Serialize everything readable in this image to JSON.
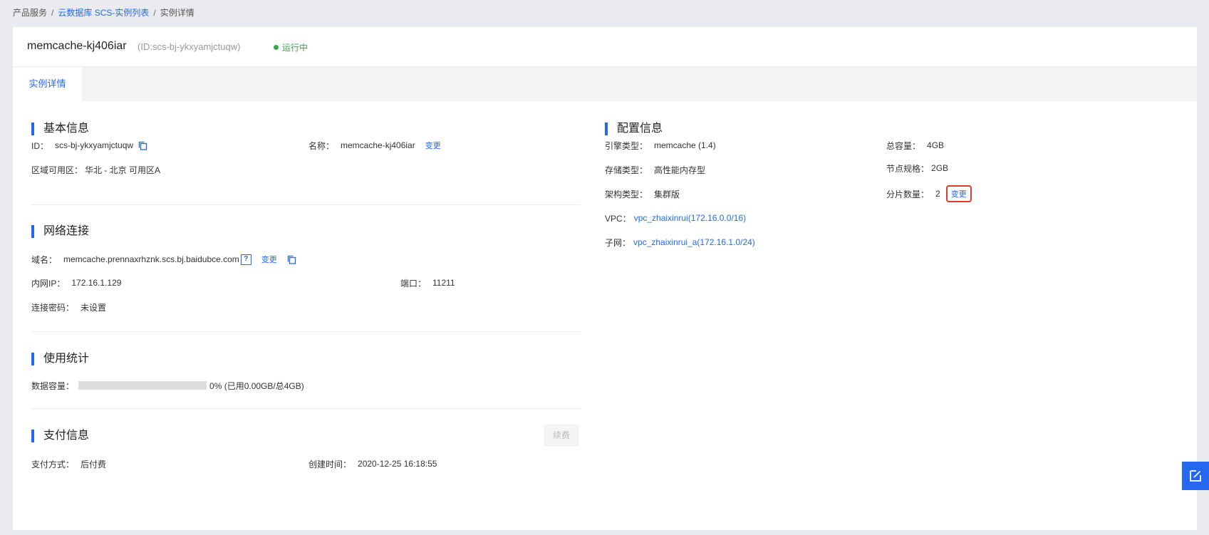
{
  "breadcrumb": {
    "items": [
      "产品服务",
      "云数据库 SCS-实例列表",
      "实例详情"
    ],
    "separator": "/"
  },
  "header": {
    "title": "memcache-kj406iar",
    "sub": "(ID:scs-bj-ykxyamjctuqw)",
    "status": "运行中"
  },
  "tabs": [
    {
      "label": "实例详情"
    }
  ],
  "basic": {
    "title": "基本信息",
    "id_label": "ID：",
    "id_value": "scs-bj-ykxyamjctuqw",
    "name_label": "名称：",
    "name_value": "memcache-kj406iar",
    "name_change": "变更",
    "zone_label": "区域可用区：",
    "zone_value": "华北 - 北京 可用区A"
  },
  "network": {
    "title": "网络连接",
    "domain_label": "域名：",
    "domain_value": "memcache.prennaxrhznk.scs.bj.baidubce.com",
    "help": "?",
    "domain_change": "变更",
    "ip_label": "内网IP：",
    "ip_value": "172.16.1.129",
    "port_label": "端口：",
    "port_value": "11211",
    "pwd_label": "连接密码：",
    "pwd_value": "未设置"
  },
  "usage": {
    "title": "使用统计",
    "cap_label": "数据容量：",
    "cap_text": "0% (已用0.00GB/总4GB)",
    "cap_fraction": 0
  },
  "payment": {
    "title": "支付信息",
    "renew": "续费",
    "method_label": "支付方式：",
    "method_value": "后付费",
    "created_label": "创建时间：",
    "created_value": "2020-12-25 16:18:55"
  },
  "config": {
    "title": "配置信息",
    "engine_label": "引擎类型：",
    "engine_value": "memcache (1.4)",
    "total_label": "总容量：",
    "total_value": "4GB",
    "storage_label": "存储类型：",
    "storage_value": "高性能内存型",
    "node_label": "节点规格：",
    "node_value": "2GB",
    "arch_label": "架构类型：",
    "arch_value": "集群版",
    "shard_label": "分片数量：",
    "shard_value": "2",
    "shard_change": "变更",
    "vpc_label": "VPC：",
    "vpc_value": "vpc_zhaixinrui(172.16.0.0/16)",
    "subnet_label": "子网：",
    "subnet_value": "vpc_zhaixinrui_a(172.16.1.0/24)"
  },
  "icons": {
    "copy": "copy-icon",
    "help": "help-icon",
    "edit": "edit-icon",
    "status_dot": "status-dot-icon"
  },
  "colors": {
    "accent": "#2468f2",
    "running": "#38a64f",
    "highlight": "#e03c2e"
  }
}
